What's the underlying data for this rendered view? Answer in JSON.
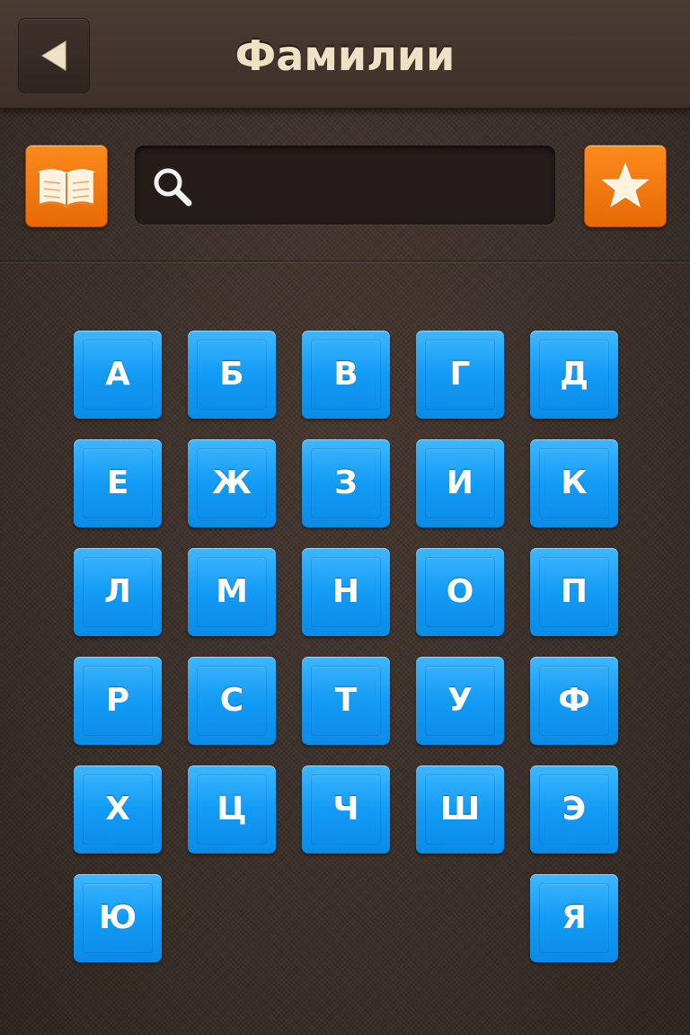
{
  "header": {
    "title": "Фамилии",
    "back_icon": "back-arrow-icon"
  },
  "toolbar": {
    "book_icon": "book-icon",
    "search": {
      "icon": "search-icon",
      "value": "",
      "placeholder": ""
    },
    "favorites_icon": "star-icon"
  },
  "colors": {
    "key_blue": "#139bf5",
    "accent_orange": "#f57d12",
    "title_cream": "#efe1c3",
    "background_brown": "#3b2e27"
  },
  "letters": [
    "А",
    "Б",
    "В",
    "Г",
    "Д",
    "Е",
    "Ж",
    "З",
    "И",
    "К",
    "Л",
    "М",
    "Н",
    "О",
    "П",
    "Р",
    "С",
    "Т",
    "У",
    "Ф",
    "Х",
    "Ц",
    "Ч",
    "Ш",
    "Э",
    "Ю",
    "Я"
  ]
}
